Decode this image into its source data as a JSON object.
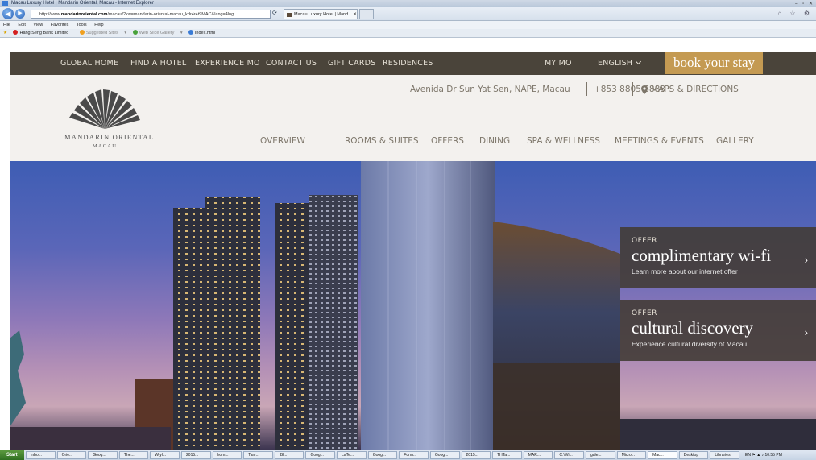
{
  "browser": {
    "window_title": "Macau Luxury Hotel | Mandarin Oriental, Macau - Internet Explorer",
    "url_prefix": "http://www.",
    "url_domain": "mandarinoriental.com",
    "url_rest": "/macau/?kw=mandarin-oriental-macau_kdr4r4t9MAC&lang=4lng",
    "tab_label": "Macau Luxury Hotel | Mand...",
    "menu": [
      "File",
      "Edit",
      "View",
      "Favorites",
      "Tools",
      "Help"
    ],
    "favorites": [
      "Hang Seng Bank Limited",
      "Suggested Sites",
      "Web Slice Gallery",
      "index.html"
    ]
  },
  "topbar": {
    "links": [
      "GLOBAL HOME",
      "FIND A HOTEL",
      "EXPERIENCE MO",
      "CONTACT US",
      "GIFT CARDS",
      "RESIDENCES"
    ],
    "my_mo": "MY MO",
    "language": "ENGLISH",
    "book_label": "book your stay",
    "colors": {
      "bar": "#4a443a",
      "book": "#c49a52"
    }
  },
  "header": {
    "logo_name": "MANDARIN ORIENTAL",
    "logo_city": "MACAU",
    "address": "Avenida Dr Sun Yat Sen, NAPE, Macau",
    "phone": "+853 8805 8888",
    "maps": "MAPS & DIRECTIONS",
    "nav": [
      "OVERVIEW",
      "ROOMS & SUITES",
      "OFFERS",
      "DINING",
      "SPA & WELLNESS",
      "MEETINGS & EVENTS",
      "GALLERY"
    ]
  },
  "offers": [
    {
      "kicker": "OFFER",
      "title": "complimentary wi-fi",
      "subtitle": "Learn more about our internet offer"
    },
    {
      "kicker": "OFFER",
      "title": "cultural discovery",
      "subtitle": "Experience cultural diversity of Macau"
    }
  ],
  "taskbar": {
    "start": "Start",
    "tasks": [
      "Inbo...",
      "Orie...",
      "Goog...",
      "The...",
      "Wiyl...",
      "2015...",
      "hom...",
      "Tanr...",
      "'Bl...",
      "Goog...",
      "LaTe...",
      "Goog...",
      "Form...",
      "Goog...",
      "2015...",
      "THTa...",
      "MAR...",
      "C:\\Wi...",
      "gale...",
      "Micro...",
      "Mac...",
      "Desktop",
      "Libraries"
    ],
    "lang": "EN",
    "clock": "10:55 PM"
  }
}
